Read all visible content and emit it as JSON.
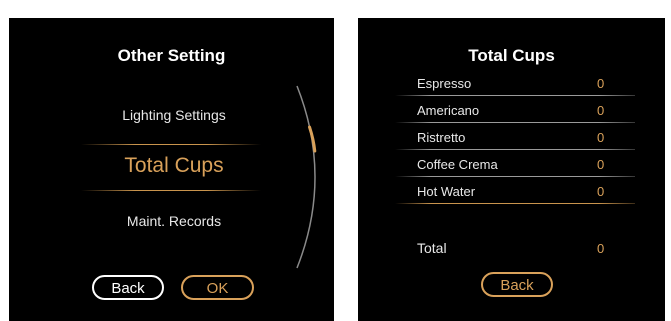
{
  "left_screen": {
    "title": "Other Setting",
    "menu": [
      {
        "label": "Lighting Settings",
        "selected": false
      },
      {
        "label": "Total Cups",
        "selected": true
      },
      {
        "label": "Maint. Records",
        "selected": false
      }
    ],
    "buttons": {
      "back": "Back",
      "ok": "OK"
    }
  },
  "right_screen": {
    "title": "Total Cups",
    "rows": [
      {
        "name": "Espresso",
        "value": "0"
      },
      {
        "name": "Americano",
        "value": "0"
      },
      {
        "name": "Ristretto",
        "value": "0"
      },
      {
        "name": "Coffee Crema",
        "value": "0"
      },
      {
        "name": "Hot Water",
        "value": "0"
      }
    ],
    "total_label": "Total",
    "total_value": "0",
    "buttons": {
      "back": "Back"
    }
  },
  "colors": {
    "screen_bg": "#000000",
    "accent_gold": "#d9a15a",
    "text_white": "#ffffff"
  }
}
